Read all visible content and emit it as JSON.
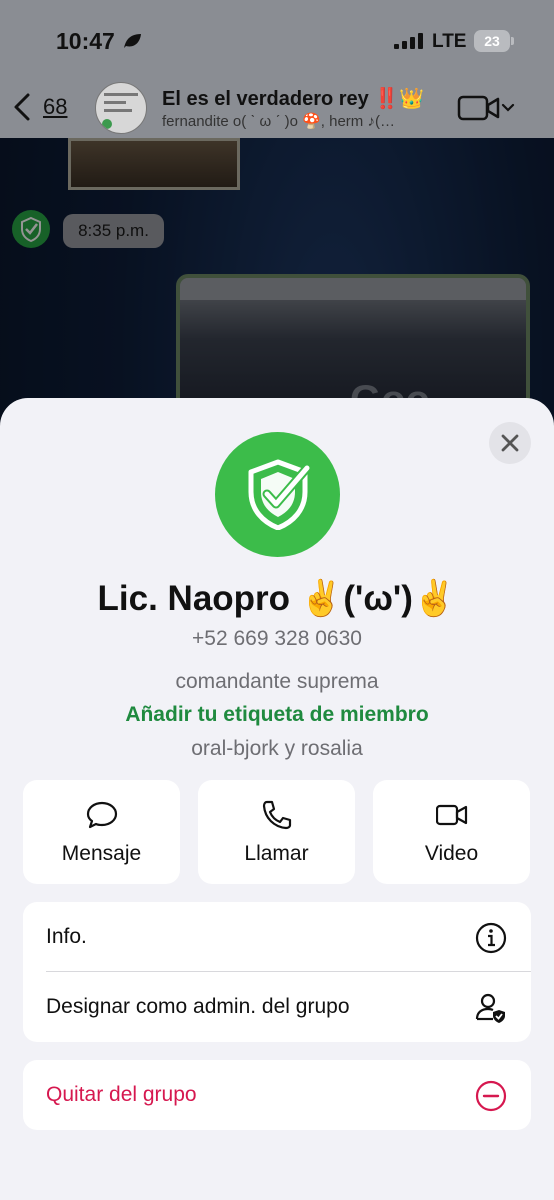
{
  "status": {
    "time": "10:47",
    "network": "LTE",
    "battery": "23"
  },
  "header": {
    "back_count": "68",
    "group_title": "El es el verdadero rey ‼️👑",
    "group_members": "fernandite o( ˋ ω ˊ )o 🍄, herm ♪(…"
  },
  "chat": {
    "timestamp": "8:35 p.m."
  },
  "contact": {
    "name": "Lic. Naopro ✌('ω')✌",
    "phone": "+52 669 328 0630",
    "tag": "comandante suprema",
    "add_tag": "Añadir tu etiqueta de miembro",
    "about": "oral-bjork y rosalia"
  },
  "actions": {
    "message": "Mensaje",
    "call": "Llamar",
    "video": "Video"
  },
  "options": {
    "info": "Info.",
    "make_admin": "Designar como admin. del grupo",
    "remove": "Quitar del grupo"
  },
  "colors": {
    "accent_green": "#1f8a3f",
    "avatar_green": "#3cbc4a",
    "danger": "#d6184f"
  }
}
